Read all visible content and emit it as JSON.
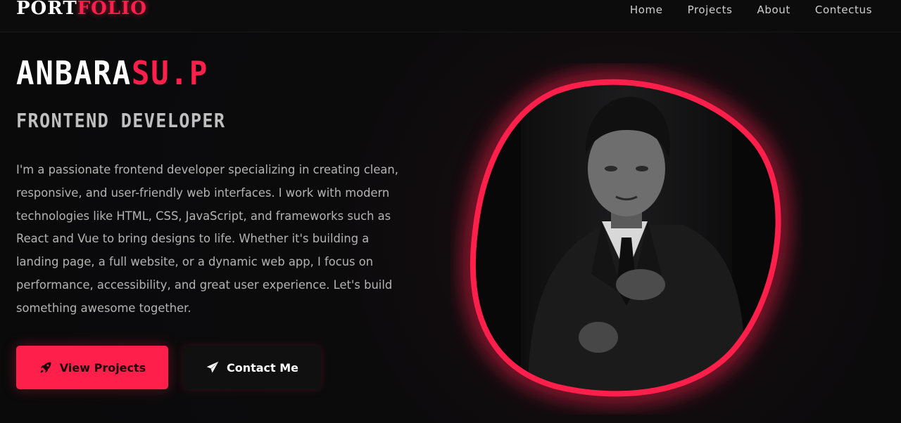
{
  "navbar": {
    "logo_part1": "PORT",
    "logo_part2": "FOLIO",
    "links": [
      "Home",
      "Projects",
      "About",
      "Contectus"
    ]
  },
  "hero": {
    "name_part1": "ANBARA",
    "name_part2": "SU.P",
    "role": "FRONTEND DEVELOPER",
    "bio": "I'm a passionate frontend developer specializing in creating clean, responsive, and user-friendly web interfaces. I work with modern technologies like HTML, CSS, JavaScript, and frameworks such as React and Vue to bring designs to life. Whether it's building a landing page, a full website, or a dynamic web app, I focus on performance, accessibility, and great user experience. Let's build something awesome together."
  },
  "buttons": {
    "primary_label": "View Projects",
    "primary_icon": "rocket-icon",
    "secondary_label": "Contact Me",
    "secondary_icon": "paper-plane-icon"
  },
  "portrait": {
    "description_icon": "profile-photo"
  },
  "colors": {
    "accent": "#ff1f4b",
    "background": "#0b0b0c",
    "text": "#d8d8d8"
  }
}
